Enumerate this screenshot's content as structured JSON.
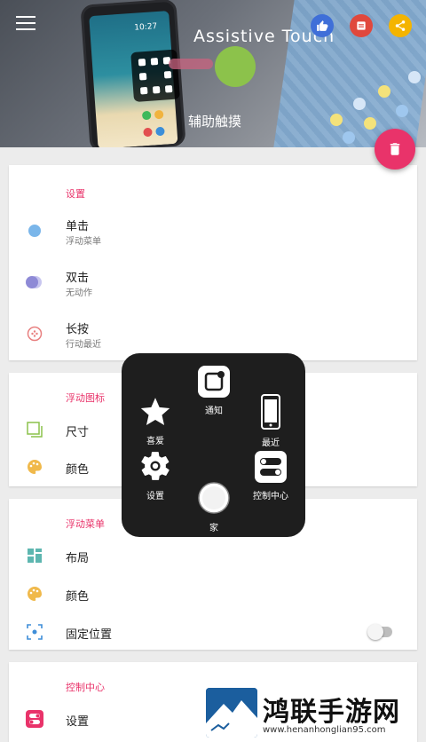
{
  "header": {
    "title": "Assistive Touch",
    "subtitle": "辅助触摸",
    "phone_time": "10:27",
    "colors": {
      "fab": "#e9336a",
      "like": "#3f6fd8",
      "note": "#e0483d",
      "share": "#f4b400",
      "ball": "#8cc24b"
    }
  },
  "toolbar": {
    "menu_icon": "menu-icon",
    "like_icon": "thumb-up-icon",
    "note_icon": "notes-icon",
    "share_icon": "share-icon",
    "delete_icon": "trash-icon"
  },
  "settings": {
    "title": "设置",
    "items": [
      {
        "label": "单击",
        "sub": "浮动菜单",
        "icon": "dot-icon",
        "color": "#7ab6ea"
      },
      {
        "label": "双击",
        "sub": "无动作",
        "icon": "double-dot-icon",
        "color": "#8e8ad6"
      },
      {
        "label": "长按",
        "sub": "行动最近",
        "icon": "ring-icon",
        "color": "#e88080"
      }
    ]
  },
  "float_icon": {
    "title": "浮动图标",
    "items": [
      {
        "label": "尺寸",
        "icon": "resize-icon",
        "color": "#8cc24b"
      },
      {
        "label": "颜色",
        "icon": "palette-icon",
        "color": "#f0b94b"
      }
    ]
  },
  "float_menu": {
    "title": "浮动菜单",
    "items": [
      {
        "label": "布局",
        "icon": "grid-icon",
        "color": "#5db6b0"
      },
      {
        "label": "颜色",
        "icon": "palette-icon",
        "color": "#f0b94b"
      },
      {
        "label": "固定位置",
        "icon": "focus-icon",
        "color": "#3f8ed8",
        "toggle": false
      }
    ]
  },
  "control_center": {
    "title": "控制中心",
    "items": [
      {
        "label": "设置",
        "icon": "toggle-settings-icon",
        "color": "#e9336a"
      }
    ]
  },
  "popup": {
    "items": [
      {
        "label": "通知",
        "icon": "notification-icon"
      },
      {
        "label": "喜爱",
        "icon": "star-icon"
      },
      {
        "label": "最近",
        "icon": "phone-icon"
      },
      {
        "label": "设置",
        "icon": "gear-icon"
      },
      {
        "label": "控制中心",
        "icon": "control-center-icon"
      },
      {
        "label": "家",
        "icon": "home-icon"
      }
    ]
  },
  "watermark": {
    "text": "鸿联手游网",
    "url": "www.henanhonglian95.com"
  }
}
